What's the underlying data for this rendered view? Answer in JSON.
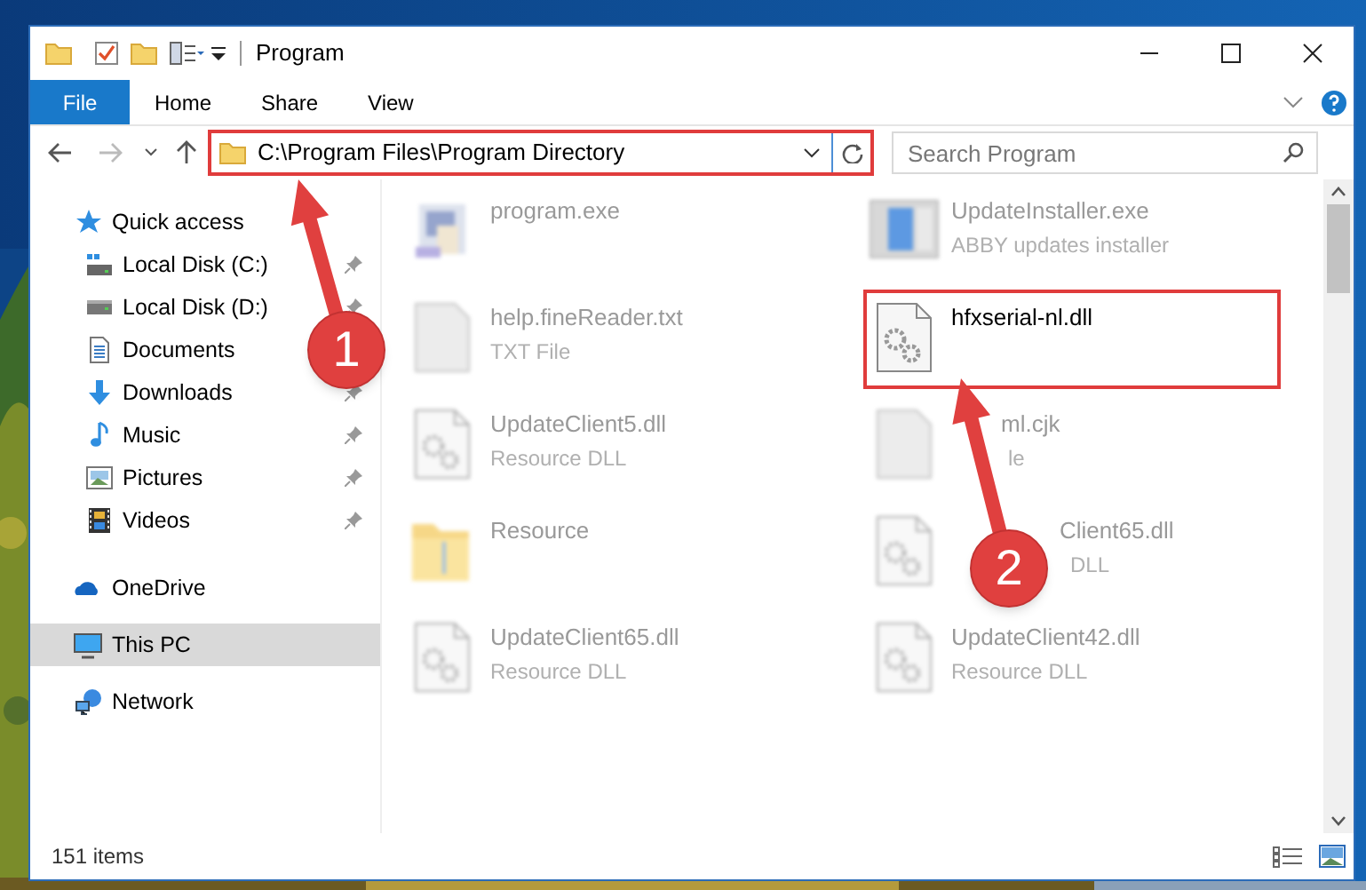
{
  "window": {
    "title": "Program"
  },
  "ribbon_tabs": [
    {
      "label": "File",
      "selected": true
    },
    {
      "label": "Home",
      "selected": false
    },
    {
      "label": "Share",
      "selected": false
    },
    {
      "label": "View",
      "selected": false
    }
  ],
  "address_bar": {
    "path": "C:\\Program Files\\Program Directory",
    "highlighted": true
  },
  "search": {
    "placeholder": "Search Program"
  },
  "sidebar": {
    "items": [
      {
        "label": "Quick access",
        "kind": "section",
        "selected": false,
        "children": [
          {
            "label": "Local Disk (C:)",
            "kind": "place",
            "selected": false,
            "pinned": true
          },
          {
            "label": "Local Disk (D:)",
            "kind": "place",
            "selected": false,
            "pinned": true
          },
          {
            "label": "Documents",
            "kind": "place",
            "selected": false
          },
          {
            "label": "Downloads",
            "kind": "place",
            "selected": false,
            "pinned": true
          },
          {
            "label": "Music",
            "kind": "place",
            "selected": false,
            "pinned": true
          },
          {
            "label": "Pictures",
            "kind": "place",
            "selected": false,
            "pinned": true
          },
          {
            "label": "Videos",
            "kind": "place",
            "selected": false,
            "pinned": true
          }
        ]
      },
      {
        "label": "OneDrive",
        "kind": "section",
        "selected": false
      },
      {
        "label": "This PC",
        "kind": "section",
        "selected": true
      },
      {
        "label": "Network",
        "kind": "section",
        "selected": false
      }
    ]
  },
  "files": [
    {
      "name": [
        "program.exe"
      ],
      "kind": "app",
      "blurred": true,
      "highlighted": false
    },
    {
      "name": [
        "UpdateInstaller.exe"
      ],
      "type": [
        "ABBY updates installer"
      ],
      "kind": "installer",
      "blurred": true,
      "highlighted": false
    },
    {
      "name": [
        "help.fineReader.txt"
      ],
      "type": [
        "TXT File"
      ],
      "kind": "blank",
      "blurred": true,
      "highlighted": false
    },
    {
      "name": [
        "hfxserial-nl.dll"
      ],
      "kind": "dll",
      "blurred": false,
      "highlighted": true
    },
    {
      "name": [
        "UpdateClient5.dll"
      ],
      "type": [
        "Resource DLL"
      ],
      "kind": "dll",
      "blurred": true,
      "highlighted": false
    },
    {
      "name": [
        "ml.cjk"
      ],
      "type": [
        "le"
      ],
      "kind": "blank",
      "blurred": true,
      "highlighted": false
    },
    {
      "name": [
        "Resource"
      ],
      "kind": "folder",
      "blurred": true,
      "highlighted": false
    },
    {
      "name": [
        "Client65.dll"
      ],
      "type": [
        "DLL"
      ],
      "kind": "dll",
      "blurred": true,
      "highlighted": false
    },
    {
      "name": [
        "UpdateClient65.dll"
      ],
      "type": [
        "Resource DLL"
      ],
      "kind": "dll",
      "blurred": true,
      "highlighted": false
    },
    {
      "name": [
        "UpdateClient42.dll"
      ],
      "type": [
        "Resource DLL"
      ],
      "kind": "dll",
      "blurred": true,
      "highlighted": false
    }
  ],
  "status_bar": {
    "item_count": "151 items"
  },
  "annotations": [
    {
      "number": "1"
    },
    {
      "number": "2"
    }
  ]
}
